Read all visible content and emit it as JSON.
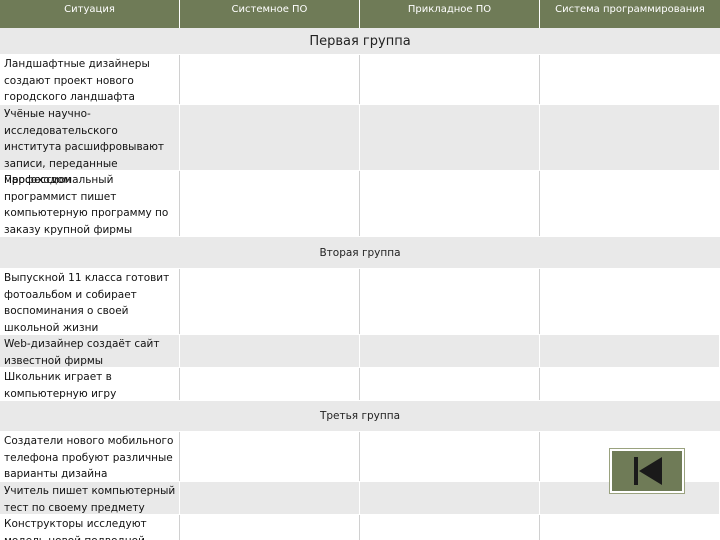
{
  "table": {
    "headers": [
      "Ситуация",
      "Системное ПО",
      "Прикладное ПО",
      "Система программирования"
    ],
    "rows": [
      {
        "kind": "group",
        "text": "Первая группа",
        "size": "large"
      },
      {
        "kind": "item",
        "text": "Ландшафтные дизайнеры создают проект нового городского ландшафта"
      },
      {
        "kind": "item",
        "text": "Учёные научно-исследовательского института расшифровывают записи, переданные марсоходом"
      },
      {
        "kind": "item",
        "text": "Профессиональный программист пишет компьютерную программу по заказу крупной фирмы"
      },
      {
        "kind": "group",
        "text": "Вторая группа",
        "size": "small"
      },
      {
        "kind": "item",
        "text": "Выпускной 11 класса готовит фотоальбом и собирает воспоминания о своей школьной жизни"
      },
      {
        "kind": "item",
        "text": "Web-дизайнер создаёт сайт известной фирмы"
      },
      {
        "kind": "item",
        "text": "Школьник играет в компьютерную игру"
      },
      {
        "kind": "group",
        "text": "Третья группа",
        "size": "small"
      },
      {
        "kind": "item",
        "text": "Создатели нового мобильного телефона пробуют различные варианты дизайна"
      },
      {
        "kind": "item",
        "text": "Учитель пишет компьютерный тест по своему предмету"
      },
      {
        "kind": "item",
        "text": "Конструкторы исследуют модель новой подводной лодки"
      }
    ]
  },
  "nav": {
    "icon": "skip-back-icon"
  },
  "colors": {
    "header": "#6f7b57",
    "row_alt": "#e9e9e9"
  }
}
